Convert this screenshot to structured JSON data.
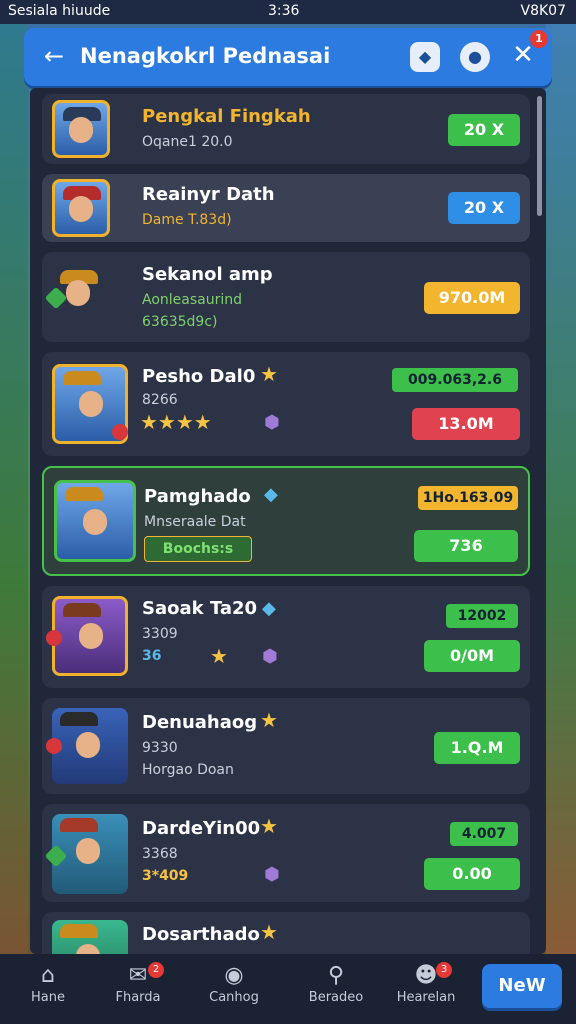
{
  "status_bar": {
    "carrier": "Sesiala hiuude",
    "time": "3:36",
    "right": "V8K07"
  },
  "header": {
    "title": "Nenagkokrl Pednasai",
    "notification_count": "1"
  },
  "rows": [
    {
      "name": "Pengkal Fingkah",
      "sub": "Oqane1 20.0",
      "price": "20 X",
      "price_color": "#3cc04b"
    },
    {
      "name": "Reainyr Dath",
      "sub": "Dame T.83d)",
      "price": "20 X",
      "price_color": "#2f8ee6"
    },
    {
      "name": "Sekanol amp",
      "sub": "Aonleasaurind",
      "sub2": "63635d9c)",
      "price": "970.0M",
      "price_color": "#f2b52d"
    },
    {
      "name": "Pesho Dal0",
      "sub": "8266",
      "pill": "009.063,2.6",
      "price": "13.0M",
      "price_color": "#e0434f"
    },
    {
      "name": "Pamghado",
      "sub": "Mnseraale Dat",
      "tag": "Boochs:s",
      "pill": "1Ho.163.09",
      "price": "736",
      "price_color": "#3cc04b"
    },
    {
      "name": "Saoak Ta20",
      "sub": "3309",
      "stars_text": "36",
      "pill": "12002",
      "price": "0/0M",
      "price_color": "#3cc04b"
    },
    {
      "name": "Denuahaog",
      "sub": "9330",
      "sub2": "Horgao Doan",
      "price": "1.Q.M",
      "price_color": "#3cc04b"
    },
    {
      "name": "DardeYin00",
      "sub": "3368",
      "stars_text": "3*409",
      "pill": "4.007",
      "price": "0.00",
      "price_color": "#3cc04b"
    },
    {
      "name": "Dosarthado",
      "sub": "",
      "price": "",
      "price_color": "#3cc04b"
    }
  ],
  "nav": {
    "tabs": [
      {
        "label": "Hane",
        "icon": "home-icon"
      },
      {
        "label": "Fharda",
        "icon": "mail-icon",
        "badge": "2"
      },
      {
        "label": "Canhog",
        "icon": "game-icon"
      },
      {
        "label": "Beradeo",
        "icon": "search-icon"
      },
      {
        "label": "Hearelan",
        "icon": "profile-icon",
        "badge": "3"
      }
    ],
    "new_button": "NeW"
  }
}
